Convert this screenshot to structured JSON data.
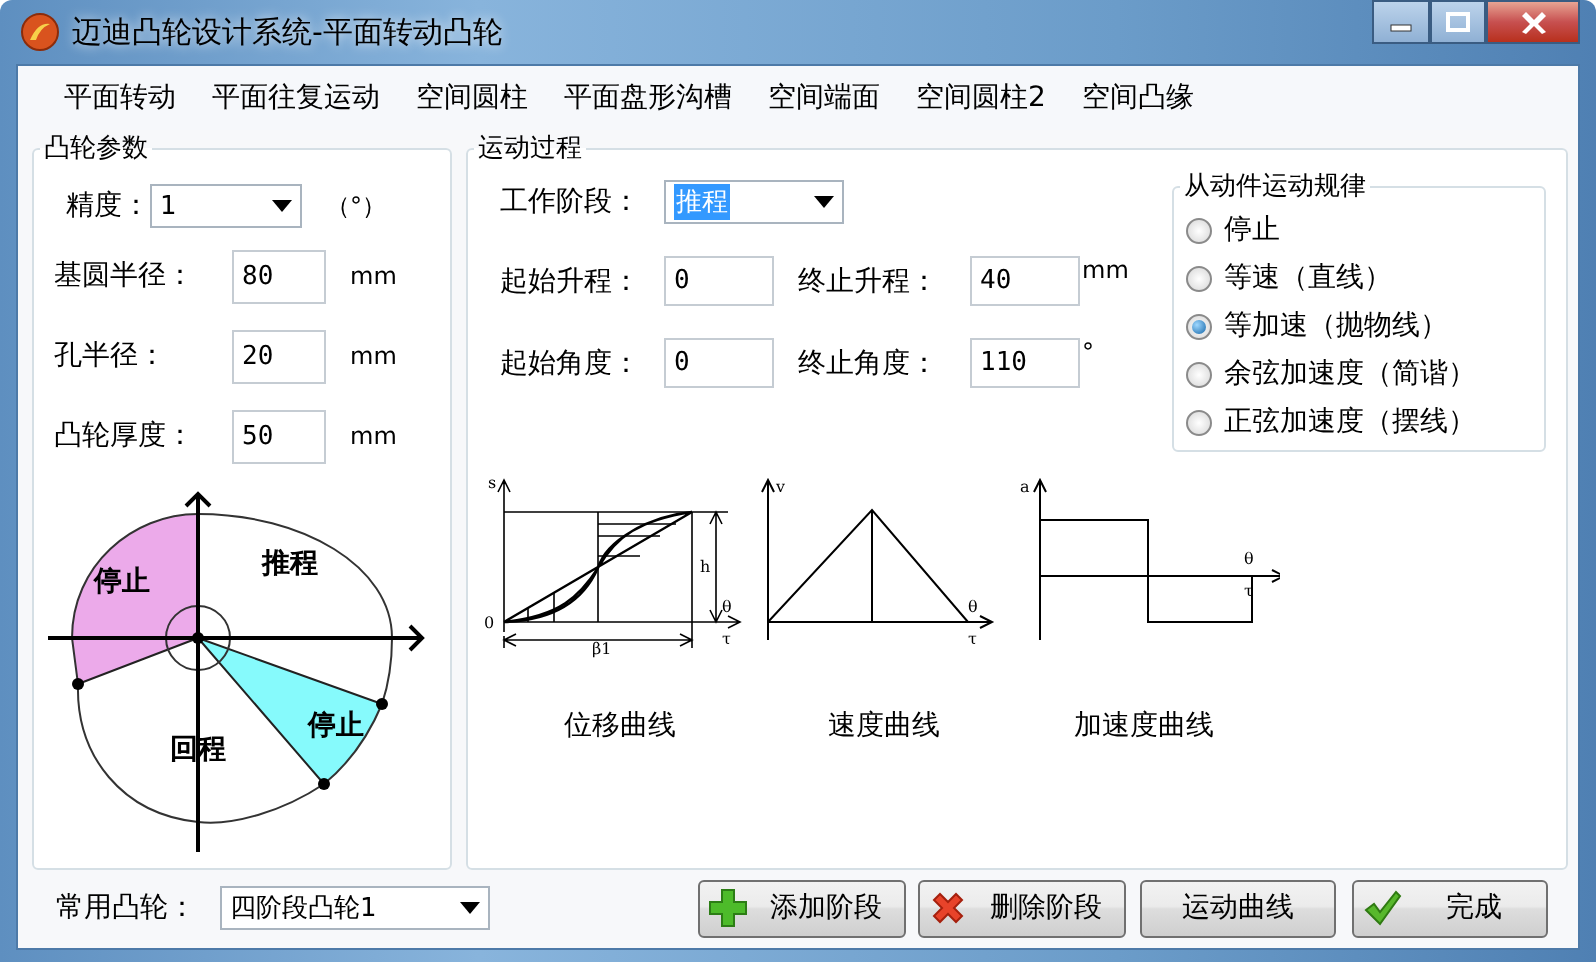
{
  "window": {
    "title": "迈迪凸轮设计系统-平面转动凸轮"
  },
  "menu": [
    {
      "label": "平面转动"
    },
    {
      "label": "平面往复运动"
    },
    {
      "label": "空间圆柱"
    },
    {
      "label": "平面盘形沟槽"
    },
    {
      "label": "空间端面"
    },
    {
      "label": "空间圆柱2"
    },
    {
      "label": "空间凸缘"
    }
  ],
  "cam_params": {
    "title": "凸轮参数",
    "fields": [
      {
        "kind": "combo",
        "label": "精度：",
        "value": "1",
        "unit": "（°）"
      },
      {
        "kind": "input",
        "label": "基圆半径：",
        "value": "80",
        "unit": "mm"
      },
      {
        "kind": "input",
        "label": "孔半径：",
        "value": "20",
        "unit": "mm"
      },
      {
        "kind": "input",
        "label": "凸轮厚度：",
        "value": "50",
        "unit": "mm"
      }
    ],
    "diagram_labels": [
      "停止",
      "推程",
      "停止",
      "回程"
    ]
  },
  "motion": {
    "title": "运动过程",
    "stage": {
      "label": "工作阶段：",
      "value": "推程"
    },
    "fields": [
      {
        "label": "起始升程：",
        "value": "0"
      },
      {
        "label": "终止升程：",
        "value": "40",
        "unit": "mm"
      },
      {
        "label": "起始角度：",
        "value": "0"
      },
      {
        "label": "终止角度：",
        "value": "110",
        "unit": "°"
      }
    ],
    "law": {
      "title": "从动件运动规律",
      "options": [
        {
          "label": "停止",
          "selected": false
        },
        {
          "label": "等速（直线）",
          "selected": false
        },
        {
          "label": "等加速（抛物线）",
          "selected": true
        },
        {
          "label": "余弦加速度（简谐）",
          "selected": false
        },
        {
          "label": "正弦加速度（摆线）",
          "selected": false
        }
      ]
    },
    "curves": [
      {
        "kind": "displacement",
        "caption": "位移曲线",
        "labels": [
          "s",
          "0",
          "h",
          "θ",
          "τ",
          "β1"
        ]
      },
      {
        "kind": "velocity",
        "caption": "速度曲线",
        "labels": [
          "v",
          "θ",
          "τ"
        ]
      },
      {
        "kind": "acceleration",
        "caption": "加速度曲线",
        "labels": [
          "a",
          "θ",
          "τ"
        ]
      }
    ]
  },
  "common_cam": {
    "label": "常用凸轮：",
    "value": "四阶段凸轮1"
  },
  "buttons": [
    {
      "label": "添加阶段",
      "kind": "plus"
    },
    {
      "label": "删除阶段",
      "kind": "cross"
    },
    {
      "label": "运动曲线",
      "kind": "plain"
    },
    {
      "label": "完成",
      "kind": "check"
    }
  ]
}
